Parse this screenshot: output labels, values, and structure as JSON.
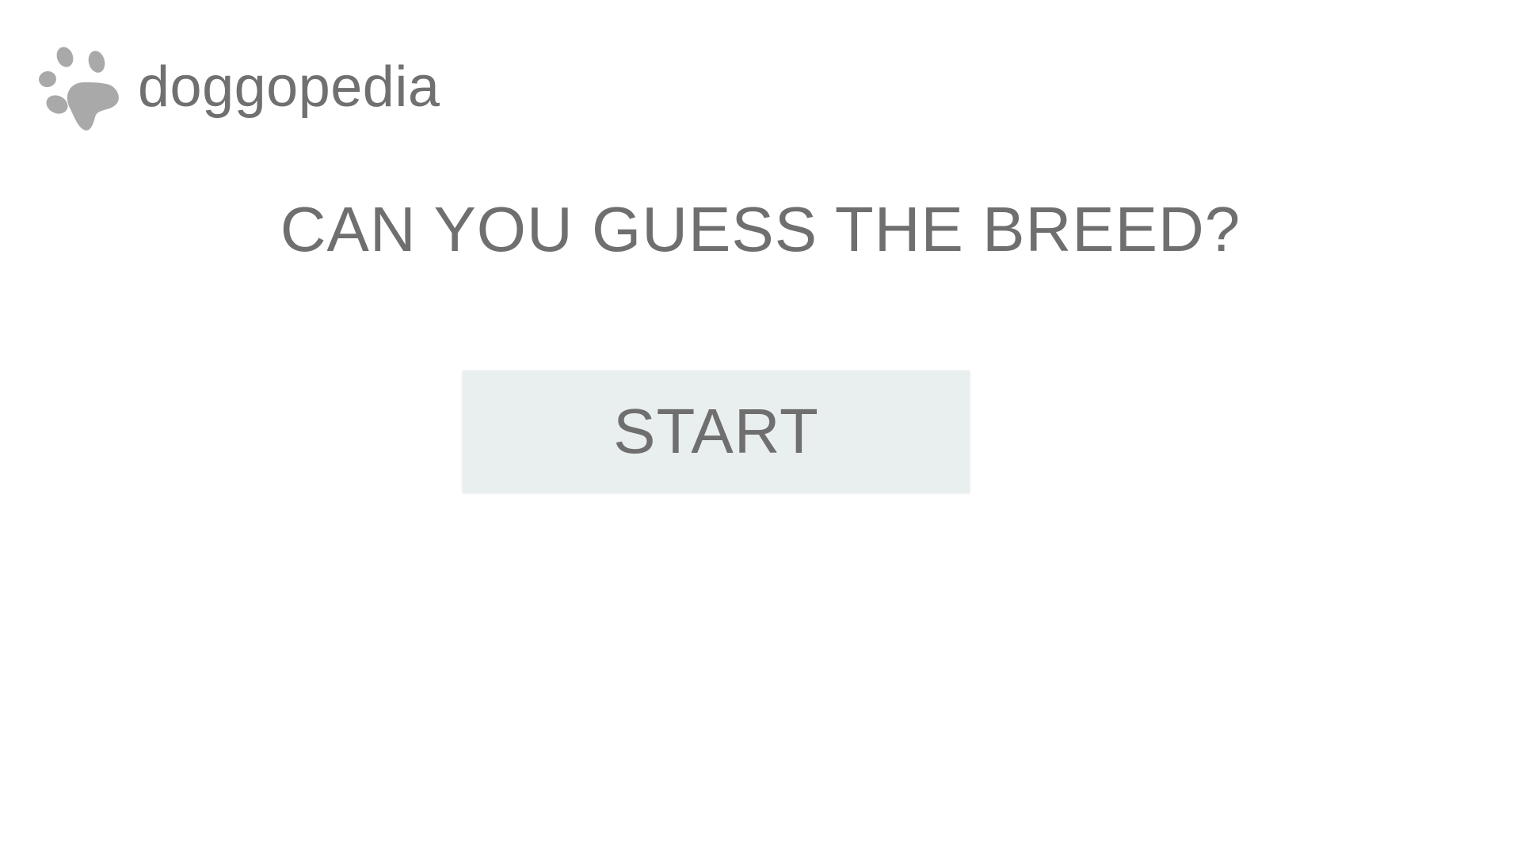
{
  "header": {
    "logo_text": "doggopedia",
    "logo_icon": "paw-icon",
    "logo_color": "#a9a9a9"
  },
  "main": {
    "title": "CAN YOU GUESS THE BREED?",
    "start_label": "START"
  },
  "colors": {
    "text": "#6f6f6f",
    "button_background": "#e9efef",
    "page_background": "#ffffff"
  }
}
